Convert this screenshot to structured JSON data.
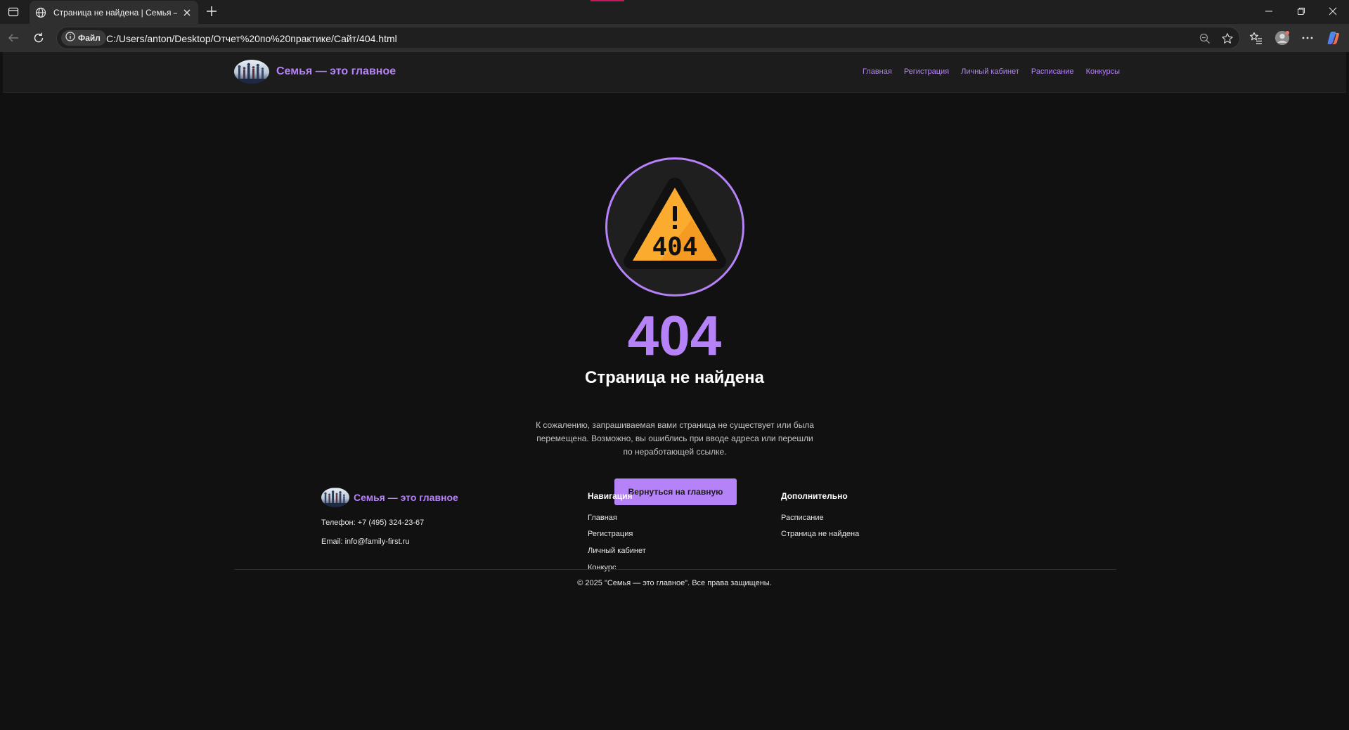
{
  "browser": {
    "tab_title": "Страница не найдена | Семья — это главное",
    "site_info_label": "Файл",
    "url": "C:/Users/anton/Desktop/Отчет%20по%20практике/Сайт/404.html"
  },
  "header": {
    "brand": "Семья — это главное",
    "nav": [
      "Главная",
      "Регистрация",
      "Личный кабинет",
      "Расписание",
      "Конкурсы"
    ]
  },
  "error": {
    "icon_label": "404",
    "code": "404",
    "title": "Страница не найдена",
    "text_lines": [
      "К сожалению, запрашиваемая вами страница не существует или была",
      "перемещена. Возможно, вы ошиблись при вводе адреса или перешли",
      "по неработающей ссылке."
    ],
    "button": "Вернуться на главную"
  },
  "footer": {
    "brand": "Семья — это главное",
    "phone": "Телефон: +7 (495) 324-23-67",
    "email": "Email: info@family-first.ru",
    "nav_heading": "Навигация",
    "nav_links": [
      "Главная",
      "Регистрация",
      "Личный кабинет",
      "Конкурс"
    ],
    "extra_heading": "Дополнительно",
    "extra_links": [
      "Расписание",
      "Страница не найдена"
    ],
    "copyright": "© 2025 \"Семья — это главное\". Все права защищены."
  },
  "colors": {
    "accent": "#b582f7",
    "background": "#111112",
    "header_bg": "#1c1c1d",
    "warning": "#fbac2f"
  }
}
